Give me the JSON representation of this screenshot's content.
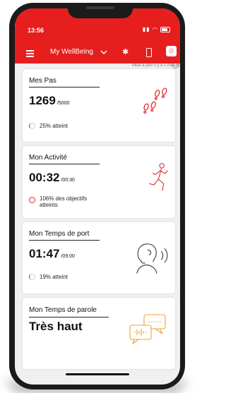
{
  "status": {
    "time": "13:56"
  },
  "header": {
    "title": "My WellBeing"
  },
  "sync": {
    "text": "Mise à jour il y a 1 minute"
  },
  "cards": {
    "steps": {
      "title": "Mes Pas",
      "value": "1269",
      "target": "/5000",
      "progress": "25% atteint",
      "progress_fraction": 0.25
    },
    "activity": {
      "title": "Mon Activité",
      "value": "00:32",
      "target": "/00:30",
      "progress": "106% des objectifs atteints",
      "progress_fraction": 1.06
    },
    "wear": {
      "title": "Mon Temps de port",
      "value": "01:47",
      "target": "/09:00",
      "progress": "19% atteint",
      "progress_fraction": 0.19
    },
    "speech": {
      "title": "Mon Temps de parole",
      "value": "Très haut"
    }
  },
  "colors": {
    "accent": "#e61e1e",
    "background": "#f0f0f0"
  },
  "icons": [
    "menu-icon",
    "chevron-down-icon",
    "bluetooth-icon",
    "phone-icon",
    "avatar-icon",
    "refresh-icon",
    "footprints-icon",
    "running-person-icon",
    "hearing-aid-head-icon",
    "speech-bubbles-icon"
  ]
}
